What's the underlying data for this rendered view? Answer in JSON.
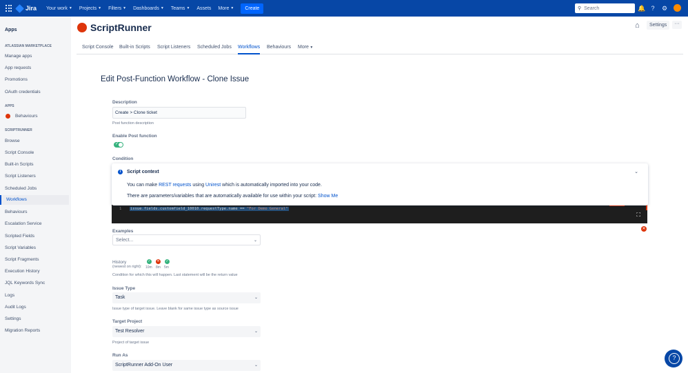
{
  "topnav": {
    "logo": "Jira",
    "items": [
      "Your work",
      "Projects",
      "Filters",
      "Dashboards",
      "Teams",
      "Assets",
      "More"
    ],
    "create": "Create",
    "search_placeholder": "Search"
  },
  "sidebar": {
    "title": "Apps",
    "marketplace_heading": "Atlassian Marketplace",
    "marketplace_items": [
      "Manage apps",
      "App requests",
      "Promotions",
      "OAuth credentials"
    ],
    "apps_heading": "Apps",
    "apps_items": [
      "Behaviours"
    ],
    "scriptrunner_heading": "ScriptRunner",
    "scriptrunner_items": [
      "Browse",
      "Script Console",
      "Built-in Scripts",
      "Script Listeners",
      "Scheduled Jobs",
      "Workflows",
      "Behaviours",
      "Escalation Service",
      "Scripted Fields",
      "Script Variables",
      "Script Fragments",
      "Execution History",
      "JQL Keywords Sync",
      "Logs",
      "Audit Logs",
      "Settings",
      "Migration Reports"
    ],
    "active": "Workflows"
  },
  "header": {
    "title": "ScriptRunner",
    "settings": "Settings",
    "more": "···"
  },
  "tabs": [
    "Script Console",
    "Built-in Scripts",
    "Script Listeners",
    "Scheduled Jobs",
    "Workflows",
    "Behaviours",
    "More"
  ],
  "page": {
    "heading": "Edit Post-Function Workflow - Clone Issue",
    "description_label": "Description",
    "description_value": "Create > Clone ticket",
    "description_help": "Post function description",
    "enable_label": "Enable Post function",
    "condition_label": "Condition",
    "popup": {
      "title": "Script context",
      "line1_a": "You can make ",
      "line1_link1": "REST requests",
      "line1_b": " using ",
      "line1_link2": "Unirest",
      "line1_c": " which is automatically imported into your code.",
      "line2_a": "There are parameters/variables that are automatically available for use within your script: ",
      "line2_link": "Show Me"
    },
    "code": {
      "line_number": "1",
      "code_a": "issue.fields.customfield_10010.requestType.name == ",
      "code_str": "\"For Demo General\""
    },
    "examples_label": "Examples",
    "examples_placeholder": "Select...",
    "history_label": "History",
    "history_sub": "(newest on right):",
    "history_times": [
      "10m",
      "8m",
      "5m"
    ],
    "condition_help": "Condition for which this will happen. Last statement will be the return value",
    "issue_type_label": "Issue Type",
    "issue_type_value": "Task",
    "issue_type_help": "Issue type of target issue. Leave blank for same issue type as source issue",
    "target_project_label": "Target Project",
    "target_project_value": "Test Resolver",
    "target_project_help": "Project of target issue",
    "run_as_label": "Run As",
    "run_as_value": "ScriptRunner Add-On User"
  },
  "colors": {
    "nav_bg": "#0747a6",
    "accent": "#0052cc",
    "success": "#36b37e",
    "error": "#de350b"
  }
}
